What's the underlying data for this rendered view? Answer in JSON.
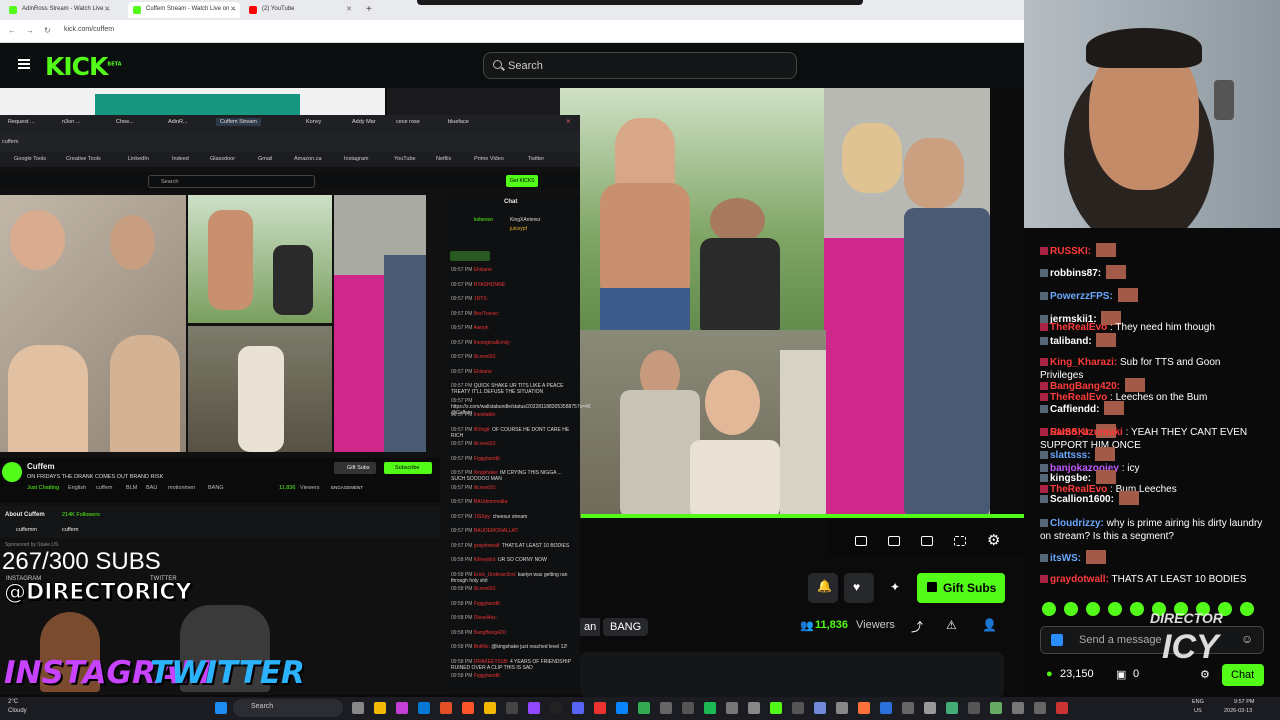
{
  "browser": {
    "tabs": [
      {
        "label": "AdinRoss Stream - Watch Live ...",
        "color": "#53fc18"
      },
      {
        "label": "Cuffem Stream - Watch Live on ...",
        "color": "#53fc18"
      },
      {
        "label": "(2) YouTube",
        "color": "#ff0000"
      }
    ],
    "new_tab": "+",
    "url": "kick.com/cuffem"
  },
  "kick": {
    "logo": "KICK",
    "logo_badge": "BETA",
    "search_placeholder": "Search"
  },
  "inner": {
    "tabs": [
      "Request ...",
      "n3on ...",
      "Chee...",
      "AdinR...",
      "Cuffem Stream",
      "Konvy",
      "Addy Mar",
      "cece rose",
      "blueface"
    ],
    "url": "cuffem",
    "bookmarks": [
      "Google Tools",
      "Creative Tools",
      "LinkedIn",
      "Indeed",
      "Glassdoor",
      "Gmail",
      "Amazon.ca",
      "Instagram",
      "YouTube",
      "Netflix",
      "Prime Video",
      "Twitter"
    ],
    "search_placeholder": "Search",
    "get_kicks": "Get KICKS",
    "chat_title": "Chat",
    "gift_row": [
      "kobeovo",
      "KingXAnterez",
      "juiceypf"
    ],
    "chat_lines": [
      {
        "t": "09:57 PM",
        "u": "Elokane",
        "m": ""
      },
      {
        "t": "09:57 PM",
        "u": "RYASHONNE:",
        "m": ""
      },
      {
        "t": "09:57 PM",
        "u": "1RTS:",
        "m": ""
      },
      {
        "t": "09:57 PM",
        "u": "BeoTravoc:",
        "m": ""
      },
      {
        "t": "09:57 PM",
        "u": "Awoyk:",
        "m": ""
      },
      {
        "t": "09:57 PM",
        "u": "theoriginaIEmily:",
        "m": ""
      },
      {
        "t": "09:57 PM",
        "u": "lilcreed10:",
        "m": ""
      },
      {
        "t": "09:57 PM",
        "u": "Elokane",
        "m": ""
      },
      {
        "t": "09:57 PM",
        "u": "",
        "m": "QUICK SHAKE UR TITS LIKE A PEACE TREATY IT'LL DEFUSE THE SITUATION"
      },
      {
        "t": "09:57 PM",
        "u": "",
        "m": "https://x.com/wallstabundle/status/2022811883053588757s=46 @Cuffem"
      },
      {
        "t": "09:57 PM",
        "u": "Inevitable:",
        "m": ""
      },
      {
        "t": "09:57 PM",
        "u": "lilVingll:",
        "m": "OF COURSE HE DONT CARE HE RICH"
      },
      {
        "t": "09:57 PM",
        "u": "lilcreed10:",
        "m": ""
      },
      {
        "t": "09:57 PM",
        "u": "Figgybandit:",
        "m": ""
      },
      {
        "t": "09:57 PM",
        "u": "Kingshake:",
        "m": "IM CRYING THIS NIGGA ... SUCH SOOOOO MAN"
      },
      {
        "t": "09:57 PM",
        "u": "lilcreed10:",
        "m": ""
      },
      {
        "t": "09:57 PM",
        "u": "BAUdemonalla:",
        "m": ""
      },
      {
        "t": "09:57 PM",
        "u": "1ISSpy:",
        "m": "cheesur stream"
      },
      {
        "t": "09:57 PM",
        "u": "BAUDEMONALLAT:",
        "m": ""
      },
      {
        "t": "09:57 PM",
        "u": "graydotwall:",
        "m": "THATS AT LEAST 10 BODIES"
      },
      {
        "t": "09:58 PM",
        "u": "Killreyldol:",
        "m": "UR SO CORNY NOW"
      },
      {
        "t": "09:58 PM",
        "u": "Erick_Underac0rst:",
        "m": "kaelyn was getting ran through holy shit"
      },
      {
        "t": "09:58 PM",
        "u": "lilcreed10:",
        "m": ""
      },
      {
        "t": "09:58 PM",
        "u": "Figgybandit:",
        "m": ""
      },
      {
        "t": "09:58 PM",
        "u": "Diesel4ss:",
        "m": ""
      },
      {
        "t": "09:58 PM",
        "u": "BangBang420:",
        "m": ""
      },
      {
        "t": "09:58 PM",
        "u": "BotRix:",
        "m": "@kingshake just reached level 12!"
      },
      {
        "t": "09:58 PM",
        "u": "DRAKEEY5SB:",
        "m": "4 YEARS OF FRIENDSHIP RUINED OVER A CLIP THIS IS SAD"
      },
      {
        "t": "09:58 PM",
        "u": "Figgybandit:",
        "m": ""
      }
    ],
    "streamer": "Cuffem",
    "stream_title": "ON FRIDAYS THE DRANK COMES OUT BRAND RISK",
    "category": "Just Chatting",
    "tags": [
      "English",
      "cuffem",
      "BLM",
      "BAU",
      "motionmen",
      "BANG"
    ],
    "viewers": "11,836",
    "viewers_label": "Viewers",
    "engagement": "ENGAGEMENT",
    "gift_subs": "Gift Subs",
    "subscribe": "Subscribe",
    "about": "About Cuffem",
    "followers": "214K Followers",
    "socials": [
      "cuffemm",
      "cuffem"
    ],
    "sponsor": "Sponsored by Stake.US"
  },
  "overlay": {
    "subs": "267/300 SUBS",
    "handle": "@DIRECTORICY",
    "instagram_label": "INSTAGRAM",
    "twitter_label": "TWITTER",
    "instagram_big": "INSTAGRAM",
    "twitter_big": "TWITTER",
    "watermark_top": "DIRECTOR",
    "watermark_bottom": "ICY"
  },
  "player": {
    "gift_subs": "Gift Subs",
    "tag_an": "an",
    "tag_bang": "BANG",
    "viewers": "11,836",
    "viewers_label": "Viewers"
  },
  "chat": {
    "lines": [
      {
        "user": "RUSSKI:",
        "color": "#ff3b3b",
        "msg": ""
      },
      {
        "user": "robbins87:",
        "color": "#ffffff",
        "msg": ""
      },
      {
        "user": "PowerzzFPS:",
        "color": "#6aa8ff",
        "msg": ""
      },
      {
        "user": "jermskii1:",
        "color": "#ffffff",
        "msg": ""
      },
      {
        "user": "TheRealEvo",
        "color": "#ff3b3b",
        "msg": ": They need him though"
      },
      {
        "user": "taliband:",
        "color": "#ffffff",
        "msg": ""
      },
      {
        "user": "King_Kharazi:",
        "color": "#ff3b3b",
        "msg": "Sub for TTS and Goon Privileges"
      },
      {
        "user": "BangBang420:",
        "color": "#ff3b3b",
        "msg": ""
      },
      {
        "user": "TheRealEvo",
        "color": "#ff3b3b",
        "msg": ": Leeches on the Bum"
      },
      {
        "user": "Caffiendd:",
        "color": "#ffffff",
        "msg": ""
      },
      {
        "user": "RUSSKI:",
        "color": "#ff3b3b",
        "msg": ""
      },
      {
        "user": "Samo_uzumaki",
        "color": "#ff3b3b",
        "msg": ": YEAH THEY CANT EVEN SUPPORT HIM ONCE"
      },
      {
        "user": "slattsss:",
        "color": "#6aa8ff",
        "msg": ""
      },
      {
        "user": "banjokazooiey",
        "color": "#c25bff",
        "msg": ": icy"
      },
      {
        "user": "kingsbe:",
        "color": "#ffffff",
        "msg": ""
      },
      {
        "user": "TheRealEvo",
        "color": "#ff3b3b",
        "msg": ": Bum Leeches"
      },
      {
        "user": "Scallion1600:",
        "color": "#ffffff",
        "msg": ""
      },
      {
        "user": "Cloudrizzy:",
        "color": "#6aa8ff",
        "msg": "why is prime airing his dirty laundry on stream? Is this a segment?"
      },
      {
        "user": "itsWS:",
        "color": "#6aa8ff",
        "msg": ""
      },
      {
        "user": "graydotwall:",
        "color": "#ff3b3b",
        "msg": "THATS AT LEAST 10 BODIES"
      }
    ],
    "send_placeholder": "Send a message",
    "points": "23,150",
    "count": "0",
    "chat_button": "Chat"
  },
  "taskbar": {
    "weather": "2°C",
    "weather_desc": "Cloudy",
    "search": "Search",
    "lang": "ENG",
    "region": "US",
    "time": "9:57 PM",
    "date": "2026-03-13"
  },
  "colors": {
    "kick_green": "#53fc18",
    "pink_dress": "#d0278a"
  }
}
